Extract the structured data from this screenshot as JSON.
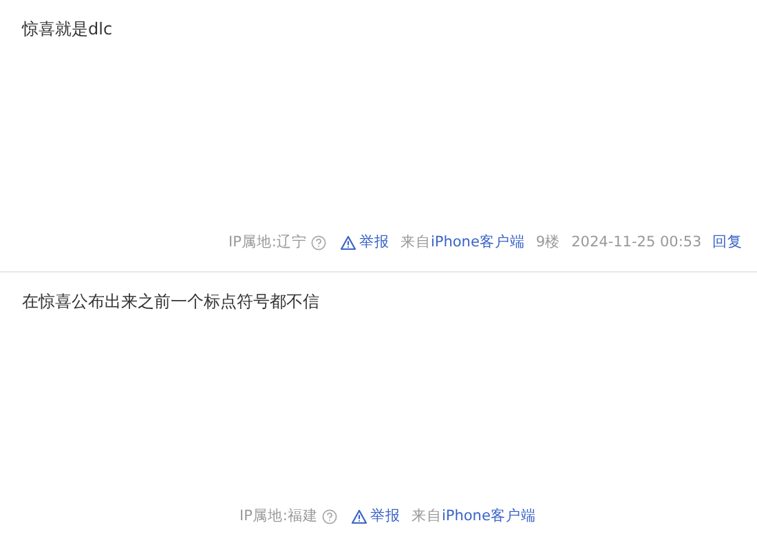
{
  "posts": [
    {
      "content": "惊喜就是dlc",
      "ip_location": "IP属地:辽宁",
      "report": "举报",
      "source_prefix": "来自",
      "source_client": "iPhone客户端",
      "floor": "9楼",
      "time": "2024-11-25 00:53",
      "reply": "回复"
    },
    {
      "content": "在惊喜公布出来之前一个标点符号都不信",
      "ip_location": "IP属地:福建",
      "report": "举报",
      "source_prefix": "来自",
      "source_client": "iPhone客户端"
    }
  ]
}
